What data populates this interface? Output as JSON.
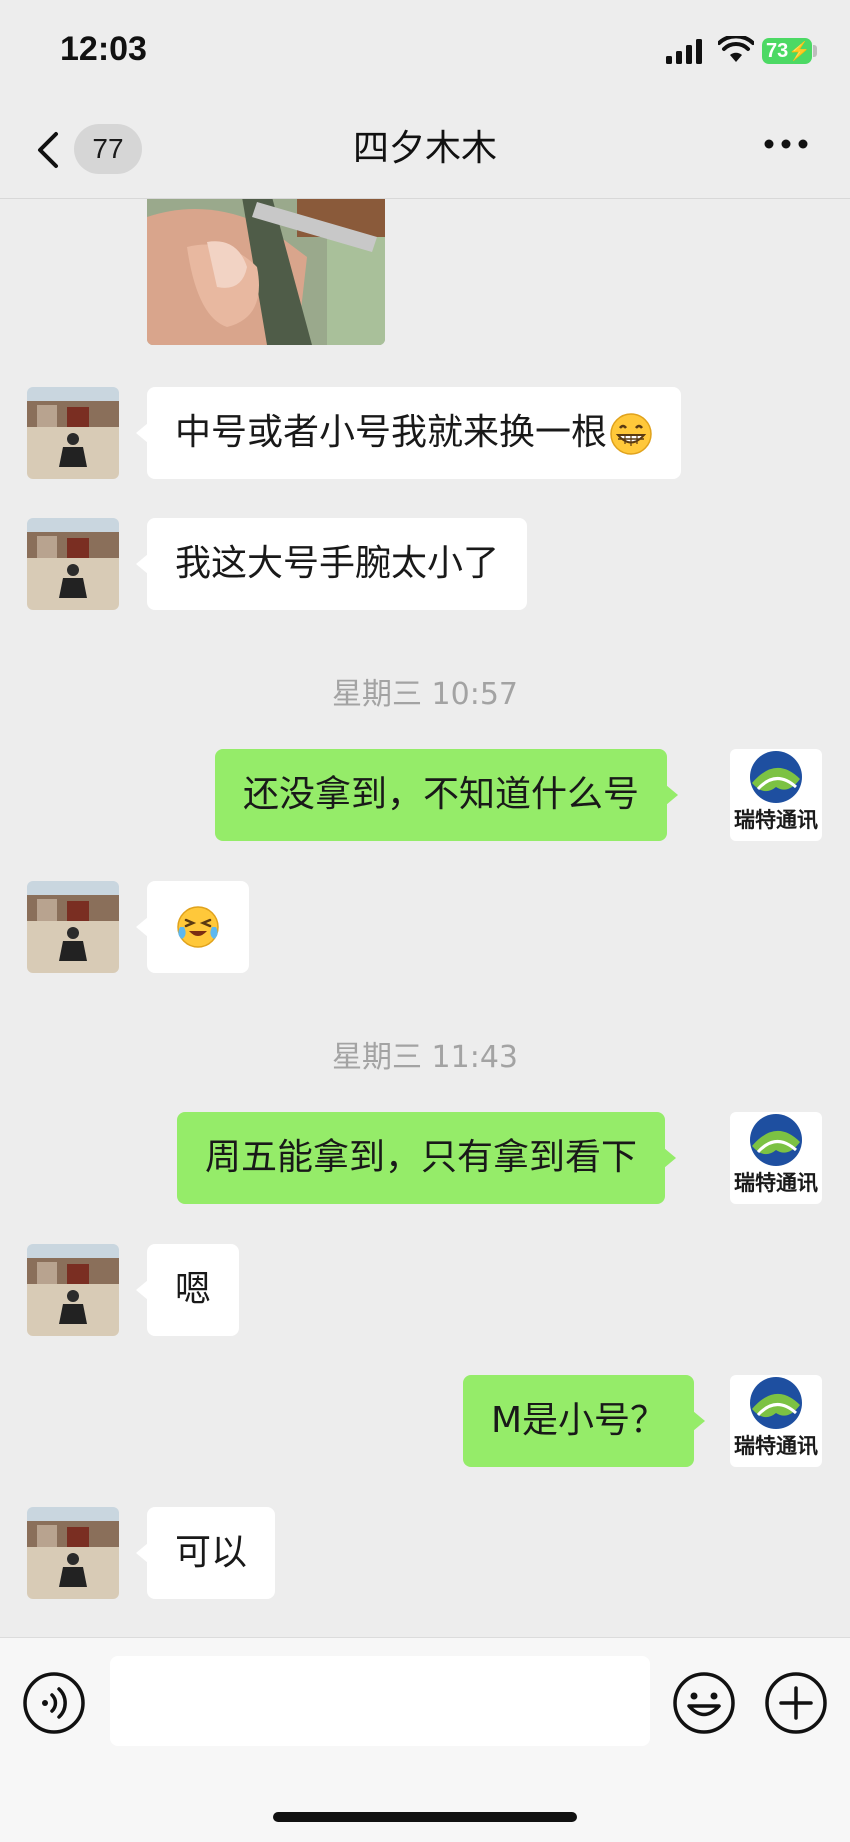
{
  "status_bar": {
    "time": "12:03",
    "battery": "73"
  },
  "nav": {
    "unread_count": "77",
    "title": "四夕木木"
  },
  "messages": [
    {
      "side": "in",
      "kind": "text",
      "text": "中号或者小号我就来换一根",
      "emoji": "grin-emoji"
    },
    {
      "side": "in",
      "kind": "text",
      "text": "我这大号手腕太小了"
    },
    {
      "kind": "timestamp",
      "text": "星期三 10:57"
    },
    {
      "side": "out",
      "kind": "text",
      "text": "还没拿到，不知道什么号"
    },
    {
      "side": "in",
      "kind": "emoji",
      "emoji": "laugh-cry-emoji"
    },
    {
      "kind": "timestamp",
      "text": "星期三 11:43"
    },
    {
      "side": "out",
      "kind": "text",
      "text": "周五能拿到，只有拿到看下"
    },
    {
      "side": "in",
      "kind": "text",
      "text": "嗯"
    },
    {
      "side": "out",
      "kind": "text",
      "text": "M是小号？"
    },
    {
      "side": "in",
      "kind": "text",
      "text": "可以"
    }
  ],
  "avatars": {
    "contact": "palace-photo-avatar",
    "self": "company-logo-avatar",
    "self_logo_text": "瑞特通讯"
  },
  "input": {
    "value": "",
    "placeholder": ""
  },
  "colors": {
    "outgoing_bubble": "#95ec69",
    "incoming_bubble": "#ffffff",
    "background": "#ededed"
  }
}
